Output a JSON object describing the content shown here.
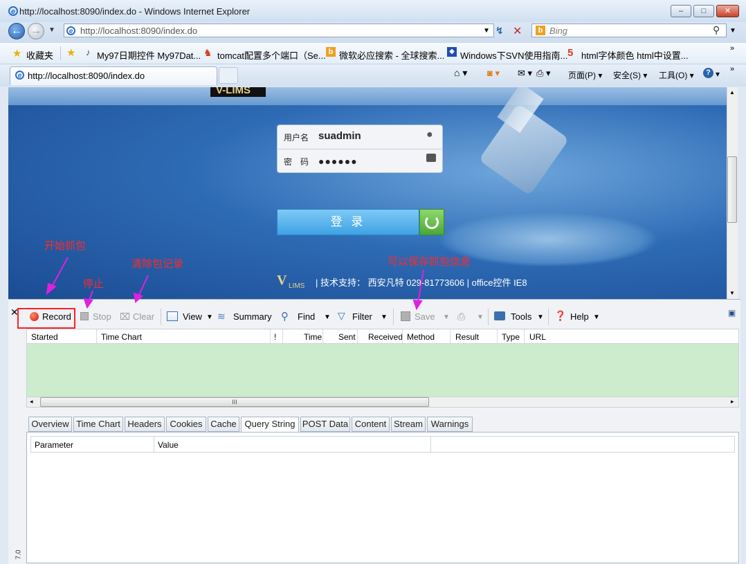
{
  "window": {
    "title": "http://localhost:8090/index.do - Windows Internet Explorer",
    "minimize": "–",
    "maximize": "□",
    "close": "✕"
  },
  "address": {
    "url": "http://localhost:8090/index.do",
    "search_placeholder": "Bing"
  },
  "favorites": {
    "label": "收藏夹",
    "items": [
      "My97日期控件 My97Dat...",
      "tomcat配置多个端口（Se...",
      "微软必应搜索 - 全球搜索...",
      "Windows下SVN使用指南...",
      "html字体颜色 html中设置..."
    ]
  },
  "tab": {
    "title": "http://localhost:8090/index.do"
  },
  "commandbar": {
    "page": "页面(P) ▾",
    "safety": "安全(S) ▾",
    "tools": "工具(O) ▾",
    "help": "? ▾"
  },
  "login": {
    "username_label": "用户名",
    "username_value": "suadmin",
    "password_label": "密　码",
    "password_value": "●●●●●●",
    "submit": "登 录",
    "footer_logo": "V",
    "footer_logo_sub": "LIMS",
    "footer_text": "|  技术支持：  西安凡特  029-81773606   |     office控件   IE8",
    "top_logo": "V-LIMS"
  },
  "fiddler": {
    "toolbar": {
      "record": "Record",
      "stop": "Stop",
      "clear": "Clear",
      "view": "View",
      "summary": "Summary",
      "find": "Find",
      "filter": "Filter",
      "save": "Save",
      "tools": "Tools",
      "help": "Help"
    },
    "columns": [
      "Started",
      "Time Chart",
      "!",
      "Time",
      "Sent",
      "Received",
      "Method",
      "Result",
      "Type",
      "URL"
    ],
    "scroll_grip": "III",
    "tabs": [
      "Overview",
      "Time Chart",
      "Headers",
      "Cookies",
      "Cache",
      "Query String",
      "POST Data",
      "Content",
      "Stream",
      "Warnings"
    ],
    "active_tab": "Query String",
    "params_headers": [
      "Parameter",
      "Value"
    ],
    "version": "7.0"
  },
  "annotations": {
    "start": "开始抓包",
    "stop": "停止",
    "clear": "清除包记录",
    "save": "可以保存抓包信息",
    "color": "#ff2a2a"
  }
}
